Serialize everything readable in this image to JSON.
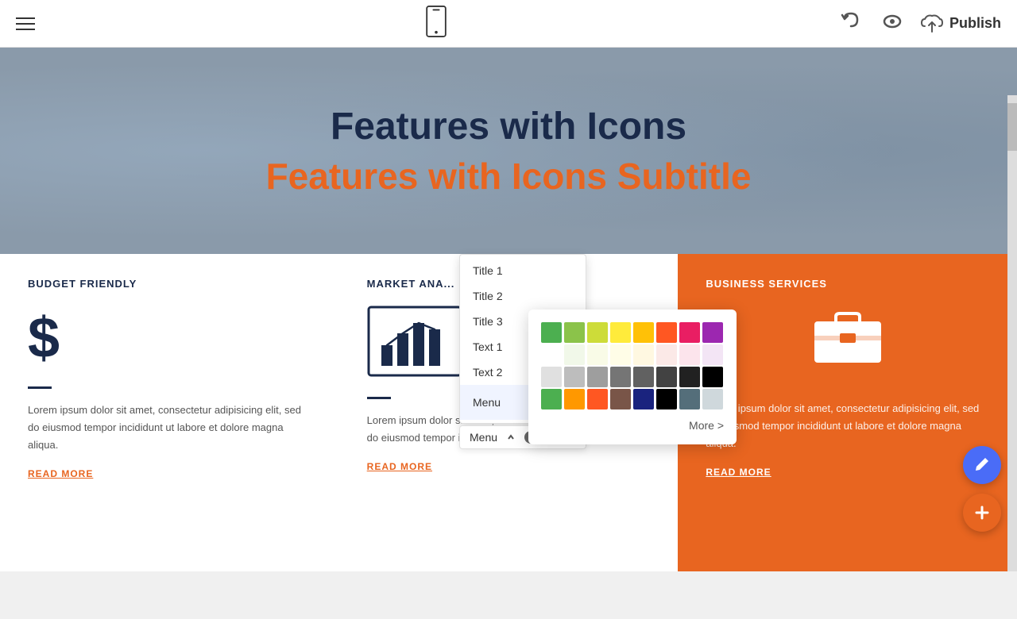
{
  "topbar": {
    "publish_label": "Publish"
  },
  "hero": {
    "title": "Features with Icons",
    "subtitle": "Features with Icons Subtitle"
  },
  "cards": [
    {
      "id": "budget",
      "title": "BUDGET FRIENDLY",
      "icon_type": "dollar",
      "text": "Lorem ipsum dolor sit amet, consectetur adipisicing elit, sed do eiusmod tempor incididunt ut labore et dolore magna aliqua.",
      "read_more": "READ MORE",
      "bg": "white"
    },
    {
      "id": "market",
      "title": "MARKET ANA...",
      "icon_type": "chart",
      "text": "Lorem ipsum dolor sit amet, consectetur adipisicing elit, sed do eiusmod tempor incididunt ut labore et dolore m...",
      "read_more": "READ MORE",
      "bg": "white"
    },
    {
      "id": "business",
      "title": "BUSINESS SERVICES",
      "icon_type": "briefcase",
      "text": "Lorem ipsum dolor sit amet, consectetur adipisicing elit, sed do eiusmod tempor incididunt ut labore et dolore magna aliqua.",
      "read_more": "READ MORE",
      "bg": "orange"
    }
  ],
  "dropdown": {
    "items": [
      {
        "label": "Title 1",
        "id": "title1"
      },
      {
        "label": "Title 2",
        "id": "title2"
      },
      {
        "label": "Title 3",
        "id": "title3"
      },
      {
        "label": "Text 1",
        "id": "text1"
      },
      {
        "label": "Text 2",
        "id": "text2"
      },
      {
        "label": "Menu",
        "id": "menu",
        "active": true
      }
    ]
  },
  "menu_bar": {
    "label": "Menu"
  },
  "color_picker": {
    "colors": [
      "#4caf50",
      "#8bc34a",
      "#cddc39",
      "#ffeb3b",
      "#ffc107",
      "#ff5722",
      "#e91e63",
      "#9c27b0",
      "#ffffff",
      "#f1f8e9",
      "#f9fbe7",
      "#fffde7",
      "#fff8e1",
      "#fbe9e7",
      "#fce4ec",
      "#f3e5f5",
      "#e0e0e0",
      "#bdbdbd",
      "#9e9e9e",
      "#757575",
      "#616161",
      "#424242",
      "#212121",
      "#000000",
      "#4caf50",
      "#ff9800",
      "#ff5722",
      "#795548",
      "#1a237e",
      "#000000",
      "#546e7a",
      "#cfd8dc"
    ],
    "more_label": "More >"
  },
  "fab": {
    "edit_title": "Edit",
    "add_title": "Add"
  }
}
